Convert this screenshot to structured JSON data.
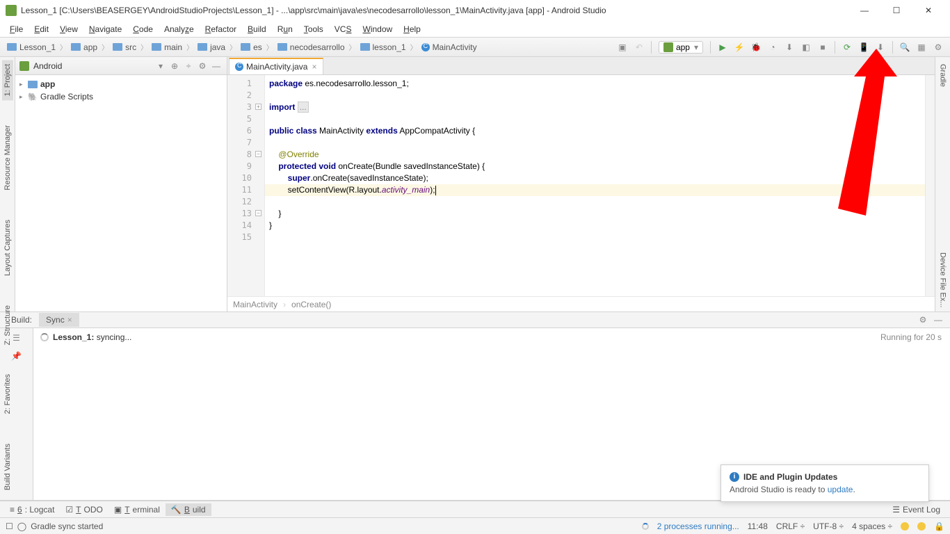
{
  "window": {
    "title": "Lesson_1 [C:\\Users\\BEASERGEY\\AndroidStudioProjects\\Lesson_1] - ...\\app\\src\\main\\java\\es\\necodesarrollo\\lesson_1\\MainActivity.java [app] - Android Studio"
  },
  "menu": [
    "File",
    "Edit",
    "View",
    "Navigate",
    "Code",
    "Analyze",
    "Refactor",
    "Build",
    "Run",
    "Tools",
    "VCS",
    "Window",
    "Help"
  ],
  "breadcrumbs": [
    "Lesson_1",
    "app",
    "src",
    "main",
    "java",
    "es",
    "necodesarrollo",
    "lesson_1",
    "MainActivity"
  ],
  "run_config": {
    "label": "app",
    "dropdown": "▾"
  },
  "left_tabs": [
    "1: Project",
    "Resource Manager",
    "Layout Captures",
    "Z: Structure",
    "2: Favorites",
    "Build Variants"
  ],
  "right_tabs_top": [
    "Gradle"
  ],
  "right_tabs_bottom": [
    "Device File Ex..."
  ],
  "project": {
    "header": "Android",
    "items": [
      {
        "label": "app",
        "type": "folder",
        "bold": true
      },
      {
        "label": "Gradle Scripts",
        "type": "gradle",
        "bold": false
      }
    ]
  },
  "editor": {
    "tab": "MainActivity.java",
    "crumbs": [
      "MainActivity",
      "onCreate()"
    ],
    "lines": [
      {
        "n": "1",
        "html": "<span class='kw'>package</span> es.necodesarrollo.lesson_1;"
      },
      {
        "n": "2",
        "html": ""
      },
      {
        "n": "3",
        "html": "<span class='kw'>import</span> <span class='fold-dots'>...</span>",
        "fold": "+"
      },
      {
        "n": "5",
        "html": ""
      },
      {
        "n": "6",
        "html": "<span class='kw'>public class</span> MainActivity <span class='kw'>extends</span> AppCompatActivity {"
      },
      {
        "n": "7",
        "html": ""
      },
      {
        "n": "8",
        "html": "    <span class='an'>@Override</span>",
        "fold": "-"
      },
      {
        "n": "9",
        "html": "    <span class='kw'>protected void</span> onCreate(Bundle savedInstanceState) {"
      },
      {
        "n": "10",
        "html": "        <span class='kw'>super</span>.onCreate(savedInstanceState);"
      },
      {
        "n": "11",
        "html": "        setContentView(R.layout.<span style='font-style:italic;color:#660e7a'>activity_main</span>);<span class='cursor'></span>",
        "hl": true
      },
      {
        "n": "12",
        "html": ""
      },
      {
        "n": "13",
        "html": "    }",
        "fold": "-"
      },
      {
        "n": "14",
        "html": "}"
      },
      {
        "n": "15",
        "html": ""
      }
    ]
  },
  "build_tabs": {
    "left": "Build:",
    "sync": "Sync"
  },
  "build": {
    "line_prefix": "Lesson_1:",
    "line_suffix": " syncing...",
    "status": "Running for 20 s"
  },
  "tool_windows": [
    "6: Logcat",
    "TODO",
    "Terminal",
    "Build"
  ],
  "tool_window_active": 3,
  "status": {
    "left": "Gradle sync started",
    "processes": "2 processes running...",
    "pos": "11:48",
    "sep": "CRLF",
    "enc": "UTF-8",
    "indent": "4 spaces"
  },
  "notification": {
    "title": "IDE and Plugin Updates",
    "body_prefix": "Android Studio is ready to ",
    "body_link": "update",
    "body_suffix": "."
  },
  "event_log": "Event Log"
}
